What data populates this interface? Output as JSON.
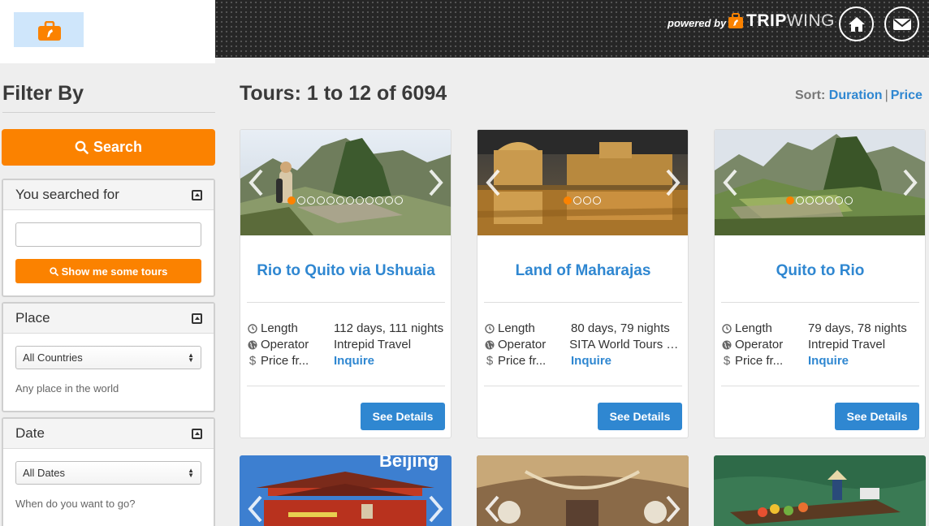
{
  "header": {
    "powered_by": "powered by",
    "brand_bold": "TRIP",
    "brand_light": "WING",
    "accent": "#fb8200",
    "icons": [
      "briefcase-logo-icon",
      "home-icon",
      "mail-icon"
    ]
  },
  "sidebar": {
    "title": "Filter By",
    "search_button": "Search",
    "searched_for": {
      "title": "You searched for",
      "input_value": "",
      "button": "Show me some tours"
    },
    "place": {
      "title": "Place",
      "selected": "All Countries",
      "hint": "Any place in the world"
    },
    "date": {
      "title": "Date",
      "selected": "All Dates",
      "hint": "When do you want to go?"
    }
  },
  "main": {
    "title": "Tours: 1 to 12 of 6094",
    "sort_label": "Sort:",
    "sort_options": [
      "Duration",
      "Price"
    ],
    "labels": {
      "length": "Length",
      "operator": "Operator",
      "price": "Price fr..."
    },
    "details_button": "See Details",
    "tours": [
      {
        "title": "Rio to Quito via Ushuaia",
        "length": "112 days, 111 nights",
        "operator": "Intrepid Travel",
        "price": "Inquire",
        "slides": 12,
        "active_slide": 1
      },
      {
        "title": "Land of Maharajas",
        "length": "80 days, 79 nights",
        "operator": "SITA World Tours O...",
        "price": "Inquire",
        "slides": 4,
        "active_slide": 1
      },
      {
        "title": "Quito to Rio",
        "length": "79 days, 78 nights",
        "operator": "Intrepid Travel",
        "price": "Inquire",
        "slides": 7,
        "active_slide": 1
      }
    ],
    "second_row": [
      {
        "overlay_text": "Beijing"
      },
      {
        "overlay_text": ""
      },
      {
        "overlay_text": ""
      }
    ]
  }
}
